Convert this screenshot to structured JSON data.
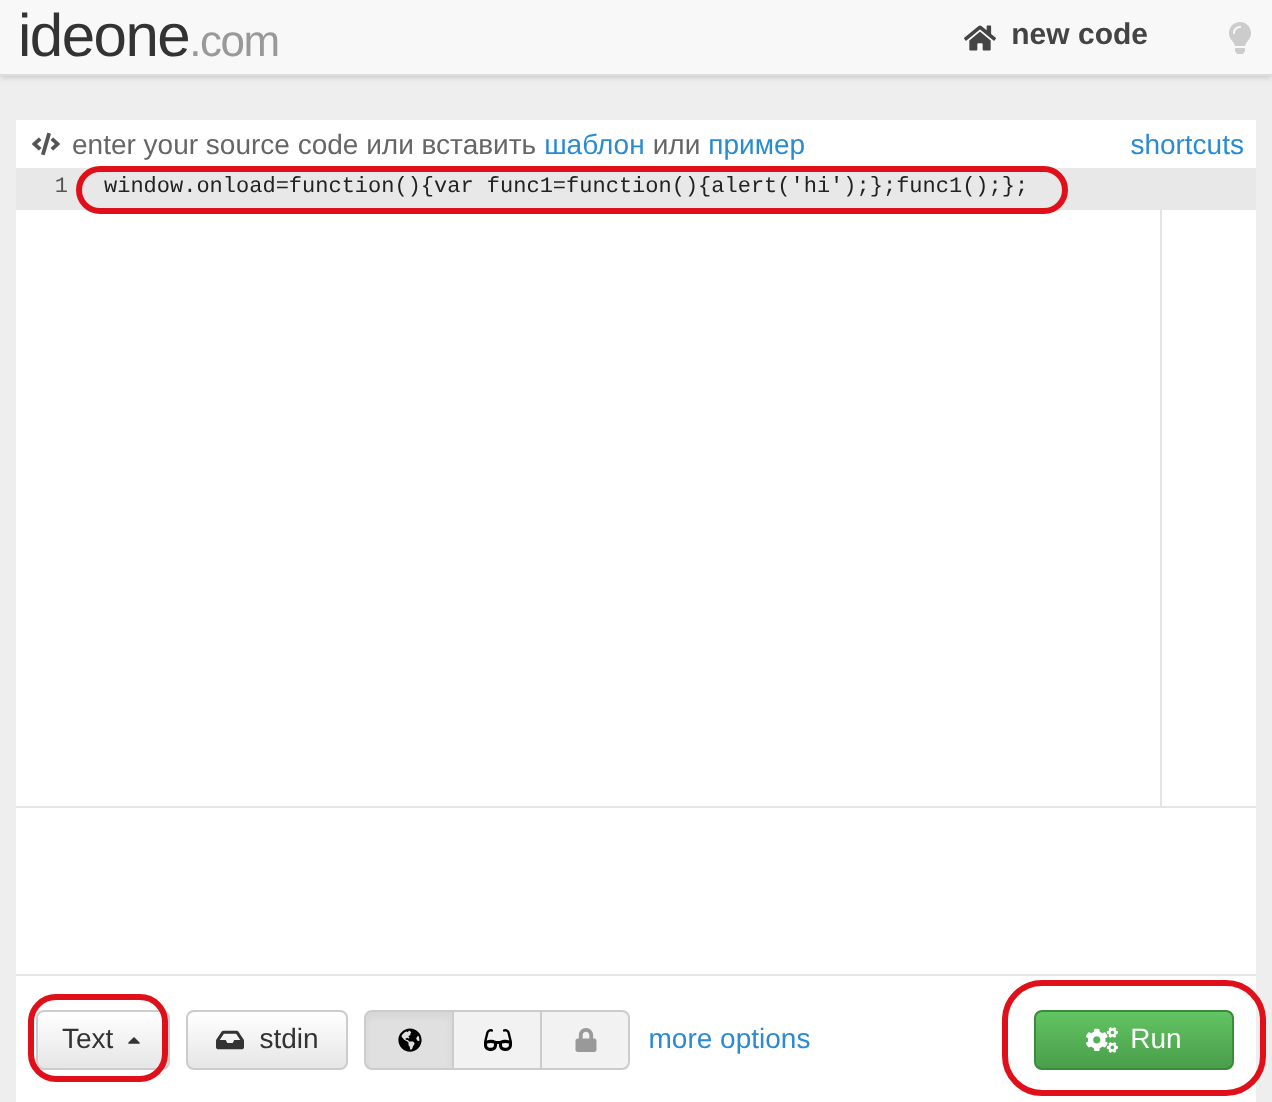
{
  "header": {
    "logo_main": "ideone",
    "logo_suffix": ".com",
    "new_code": "new code"
  },
  "editor": {
    "prompt": "enter your source code или вставить",
    "template_link": "шаблон",
    "or": "или",
    "example_link": "пример",
    "shortcuts": "shortcuts",
    "lines": [
      {
        "number": "1",
        "code": "window.onload=function(){var func1=function(){alert('hi');};func1();};",
        "active": true
      }
    ]
  },
  "toolbar": {
    "language": "Text",
    "stdin": "stdin",
    "visibility": [
      {
        "kind": "public",
        "selected": true
      },
      {
        "kind": "hidden",
        "selected": false
      },
      {
        "kind": "private",
        "selected": false
      }
    ],
    "more_options": "more options",
    "run": "Run"
  }
}
